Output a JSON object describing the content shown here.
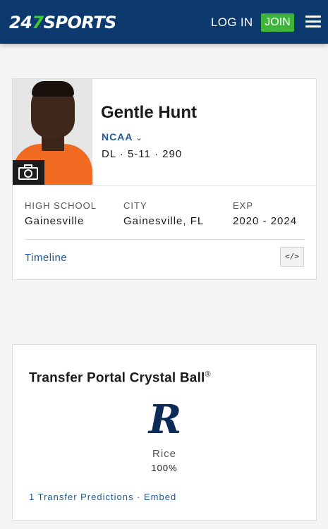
{
  "header": {
    "logo_prefix": "24",
    "logo_seven": "7",
    "logo_suffix": "SPORTS",
    "login_label": "LOG IN",
    "join_label": "JOIN",
    "colors": {
      "bar": "#0d3a6e",
      "join": "#3eb53a",
      "logo_accent": "#3ccb2a"
    }
  },
  "profile": {
    "name": "Gentle Hunt",
    "league": "NCAA",
    "position_line": "DL · 5-11 · 290",
    "photo_icon": "camera-icon",
    "details": [
      {
        "label": "HIGH SCHOOL",
        "value": "Gainesville"
      },
      {
        "label": "CITY",
        "value": "Gainesville, FL"
      },
      {
        "label": "EXP",
        "value": "2020 - 2024"
      }
    ],
    "timeline_label": "Timeline",
    "embed_label": "</>"
  },
  "crystal_ball": {
    "title": "Transfer Portal Crystal Ball",
    "title_mark": "®",
    "school_logo_letter": "R",
    "school_name": "Rice",
    "percentage": "100%",
    "footer": "1 Transfer Predictions · Embed",
    "colors": {
      "school": "#0a2a57",
      "link": "#1c5a99"
    }
  }
}
